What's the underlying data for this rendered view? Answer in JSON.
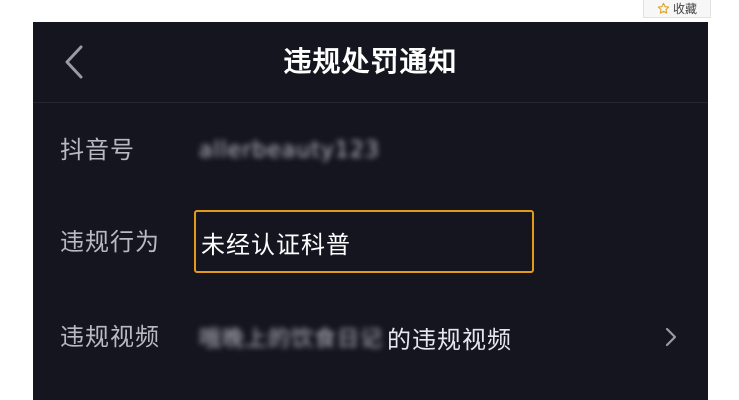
{
  "fav_chip": {
    "label": "收藏",
    "icon": "star-icon"
  },
  "nav": {
    "back_icon": "chevron-left-icon",
    "title": "违规处罚通知"
  },
  "rows": {
    "account": {
      "label": "抖音号",
      "value": "allerbeauty123"
    },
    "behavior": {
      "label": "违规行为",
      "value": "未经认证科普"
    },
    "video": {
      "label": "违规视频",
      "value_blurred": "哦晚上的饮食日记",
      "value_suffix": "的违规视频",
      "chevron_icon": "chevron-right-icon"
    }
  },
  "colors": {
    "screen_bg": "#151520",
    "highlight_border": "#e39a1a",
    "label_text": "#b9b9c4",
    "title_text": "#ffffff"
  }
}
